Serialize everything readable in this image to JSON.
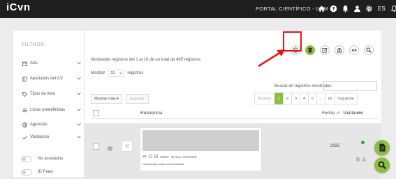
{
  "topbar": {
    "logo": "iCvn",
    "portal": "PORTAL CIENTÍFICO - UAM",
    "lang": "ES"
  },
  "sidebar": {
    "title": "FILTROS",
    "filters": [
      {
        "label": "Año",
        "icon": "calendar-icon"
      },
      {
        "label": "Apartados del CV",
        "icon": "book-icon"
      },
      {
        "label": "Tipos de ítem",
        "icon": "tag-icon"
      },
      {
        "label": "Listas predefinidas",
        "icon": "list-icon"
      },
      {
        "label": "Agencias",
        "icon": "globe-icon"
      },
      {
        "label": "Validación",
        "icon": "check-icon"
      }
    ],
    "toggles": [
      {
        "label": "No asociados"
      },
      {
        "label": "ID Feed"
      }
    ]
  },
  "main": {
    "info": "Mostrando registros del 1 al 10 de un total de 495 registros.",
    "show_prefix": "Mostrar",
    "show_value": "10",
    "show_suffix": "registros",
    "search_label": "Buscar en registros mostrados:",
    "search_value": "",
    "more_label": "Mostrar más ▾",
    "export_label": "Exportar",
    "pager": [
      "Anterior",
      "1",
      "2",
      "3",
      "4",
      "5",
      "...",
      "50",
      "Siguiente"
    ],
    "columns": {
      "reference": "Referencia",
      "date": "Fecha",
      "validation": "Validación"
    },
    "row": {
      "thumb": "N",
      "meta_count": "32650",
      "meta_id": "ID Item: 10246145",
      "org": "Universidad Autónoma de Madrid",
      "year": "2025"
    }
  },
  "colors": {
    "accent": "#8bbf3f",
    "topbar": "#1e1e1e",
    "highlight": "#e11111",
    "status": "#3a9a34"
  }
}
